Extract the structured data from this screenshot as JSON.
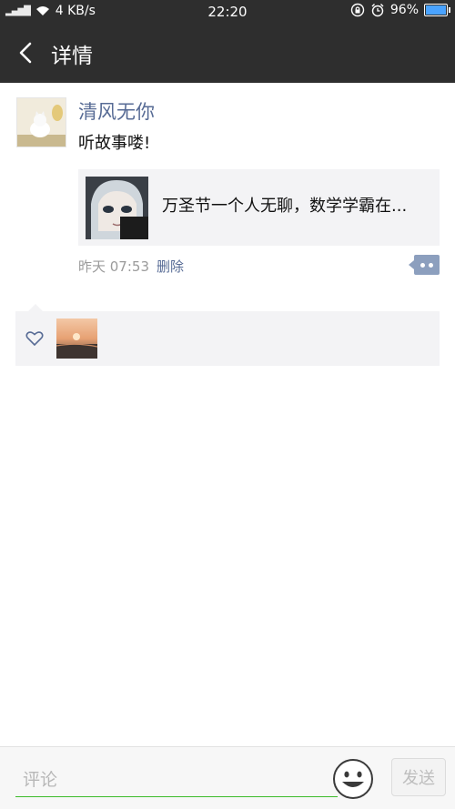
{
  "status_bar": {
    "network": "4 KB/s",
    "time": "22:20",
    "battery": "96%",
    "icons": [
      "signal-icon",
      "wifi-icon",
      "lock-rotation-icon",
      "alarm-icon",
      "battery-icon"
    ]
  },
  "header": {
    "title": "详情"
  },
  "post": {
    "author": "清风无你",
    "content": "听故事喽!",
    "share": {
      "title": "万圣节一个人无聊，数学学霸在..."
    },
    "time": "昨天 07:53",
    "delete_label": "删除"
  },
  "comment": {
    "placeholder": "评论",
    "send_label": "发送"
  },
  "colors": {
    "bar_dark": "#2e2e2e",
    "link_blue": "#576b95",
    "input_green": "#3dbb2b"
  }
}
